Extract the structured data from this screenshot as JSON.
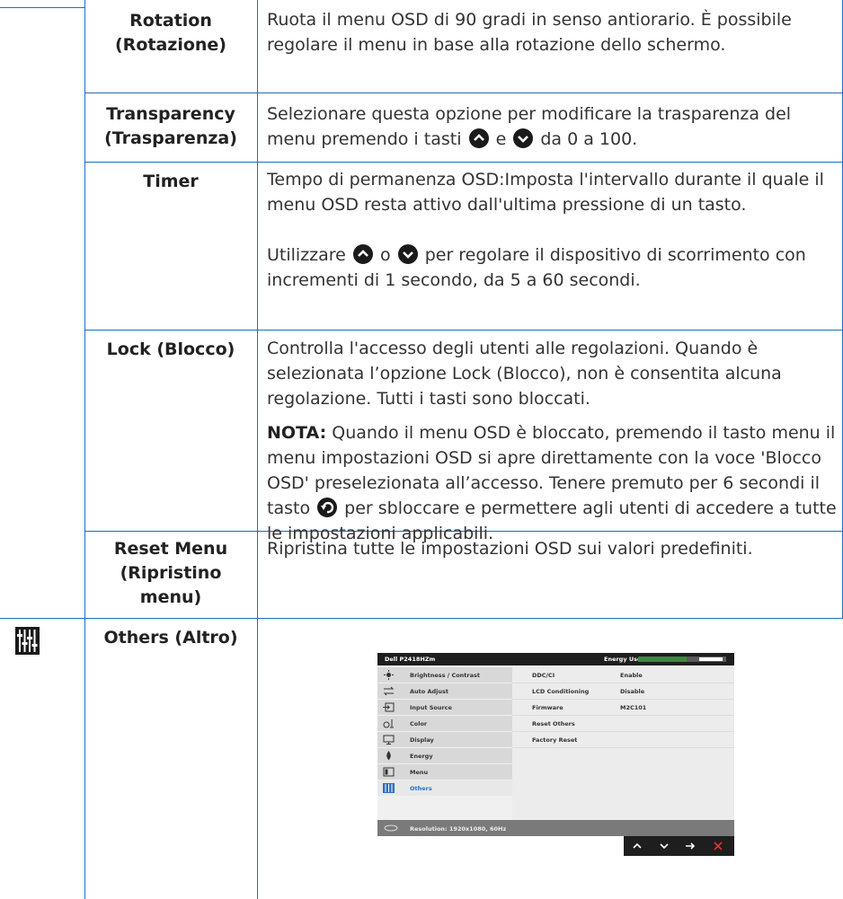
{
  "rows": [
    {
      "name_line1": "Rotation",
      "name_line2": "(Rotazione)",
      "desc": "Ruota il menu OSD di 90 gradi in senso antiorario. È possibile regolare il menu in base alla rotazione dello schermo."
    },
    {
      "name_line1": "Transparency",
      "name_line2": "(Trasparenza)",
      "desc_a": "Selezionare questa opzione per modificare la trasparenza del menu premendo i tasti",
      "desc_b": "e",
      "desc_c": "da 0 a 100."
    },
    {
      "name_line1": "Timer",
      "desc1": "Tempo di permanenza OSD:Imposta l'intervallo durante il quale il menu OSD resta attivo dall'ultima pressione di un tasto.",
      "desc2_a": "Utilizzare",
      "desc2_b": "o",
      "desc2_c": "per regolare il dispositivo di scorrimento con incrementi di 1 secondo, da 5 a 60 secondi."
    },
    {
      "name_line1": "Lock (Blocco)",
      "desc1": "Controlla l'accesso degli utenti alle regolazioni. Quando è selezionata l’opzione Lock (Blocco), non è consentita alcuna regolazione. Tutti i tasti sono bloccati.",
      "note_label": "NOTA:",
      "note_a": " Quando il menu OSD è bloccato, premendo il tasto menu il menu impostazioni OSD si apre direttamente con la voce 'Blocco OSD' preselezionata all’accesso. Tenere premuto per 6 secondi il tasto",
      "note_b": "per sbloccare e permettere agli utenti di accedere a tutte le impostazioni applicabili."
    },
    {
      "name_line1": "Reset Menu",
      "name_line2": "(Ripristino",
      "name_line3": "menu)",
      "desc": "Ripristina tutte le impostazioni OSD sui valori predefiniti."
    },
    {
      "name_line1": "Others (Altro)"
    }
  ],
  "osd": {
    "model": "Dell P2418HZm",
    "energy_label": "Energy Use",
    "energy_level": 0.55,
    "menu": [
      {
        "label": "Brightness / Contrast",
        "icon": "sun-icon"
      },
      {
        "label": "Auto Adjust",
        "icon": "auto-adjust-icon"
      },
      {
        "label": "Input Source",
        "icon": "input-source-icon"
      },
      {
        "label": "Color",
        "icon": "color-icon"
      },
      {
        "label": "Display",
        "icon": "display-icon"
      },
      {
        "label": "Energy",
        "icon": "energy-icon"
      },
      {
        "label": "Menu",
        "icon": "menu-icon"
      },
      {
        "label": "Others",
        "icon": "others-icon"
      }
    ],
    "settings": [
      {
        "key": "DDC/CI",
        "value": "Enable"
      },
      {
        "key": "LCD Conditioning",
        "value": "Disable"
      },
      {
        "key": "Firmware",
        "value": "M2C101"
      },
      {
        "key": "Reset Others",
        "value": ""
      },
      {
        "key": "Factory Reset",
        "value": ""
      }
    ],
    "resolution": "Resolution: 1920x1080, 60Hz"
  },
  "colors": {
    "rule": "#1a6fbf",
    "osd_selected": "#2c6fbe",
    "close_x": "#e0303a",
    "energy_bar": "#3a8a3a"
  }
}
